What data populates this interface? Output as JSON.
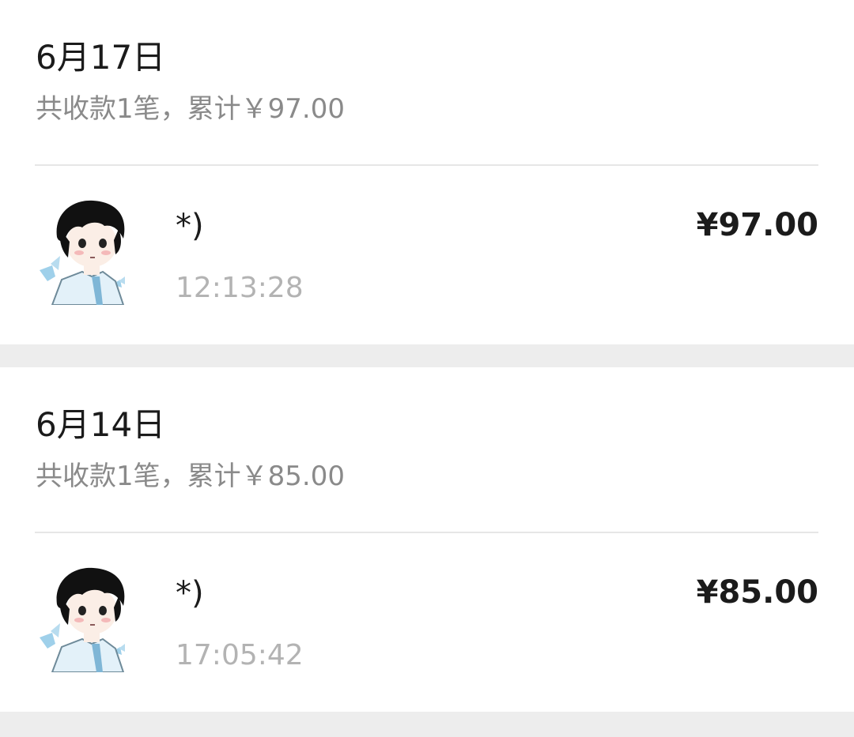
{
  "days": [
    {
      "date": "6月17日",
      "summary": "共收款1笔，累计￥97.00",
      "transactions": [
        {
          "avatar_icon": "cartoon-boy-avatar",
          "payer": "*)",
          "time": "12:13:28",
          "amount": "¥97.00"
        }
      ]
    },
    {
      "date": "6月14日",
      "summary": "共收款1笔，累计￥85.00",
      "transactions": [
        {
          "avatar_icon": "cartoon-boy-avatar",
          "payer": "*)",
          "time": "17:05:42",
          "amount": "¥85.00"
        }
      ]
    }
  ],
  "colors": {
    "background": "#ededed",
    "card": "#ffffff",
    "primary_text": "#1b1b1b",
    "secondary_text": "#8a8a8a",
    "time_text": "#b3b3b3",
    "divider": "#e6e6e6",
    "avatar_accent": "#9fd0ea"
  }
}
